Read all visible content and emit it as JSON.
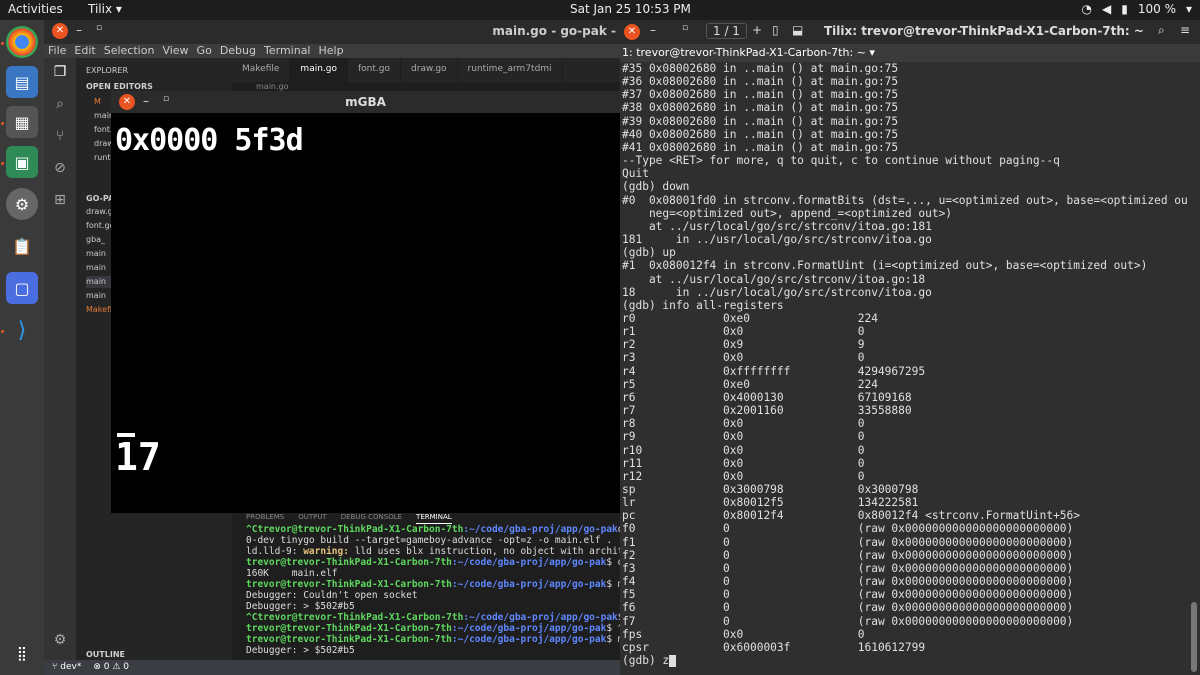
{
  "topbar": {
    "activities": "Activities",
    "app": "Tilix",
    "app_arrow": "▾",
    "clock": "Sat Jan 25  10:53 PM",
    "battery": "100 %"
  },
  "vscode": {
    "title": "main.go - go-pak -",
    "menu": [
      "File",
      "Edit",
      "Selection",
      "View",
      "Go",
      "Debug",
      "Terminal",
      "Help"
    ],
    "explorer": "EXPLORER",
    "open_editors": "OPEN EDITORS",
    "project": "GO-PAK",
    "open_files": [
      "M",
      "main.go",
      "font.go",
      "draw.go",
      "runtime_arm7tdmi"
    ],
    "project_files": [
      "draw.go",
      "font.go",
      "gba_",
      "main",
      "main",
      "main",
      "main",
      "Makefile"
    ],
    "outline": "OUTLINE",
    "tabs": [
      "Makefile",
      "main.go",
      "font.go",
      "draw.go",
      "runtime_arm7tdmi"
    ],
    "breadcrumb": "main.go",
    "terminal_tabs": [
      "PROBLEMS",
      "OUTPUT",
      "DEBUG CONSOLE",
      "TERMINAL"
    ],
    "status": {
      "branch": "dev*",
      "errors": "⊗ 0 ⚠ 0"
    }
  },
  "terminal_lines": [
    {
      "u": "^Ctrevor@trevor-ThinkPad-X1-Carbon-7th",
      "p": ":~/code/gba-proj/app/go-pak",
      "c": "docker run"
    },
    {
      "t": "0-dev tinygo build --target=gameboy-advance -opt=z -o main.elf ."
    },
    {
      "w": "ld.lld-9: ",
      "y": "warning:",
      "t": " lld uses blx instruction, no object with architecture su"
    },
    {
      "u": "trevor@trevor-ThinkPad-X1-Carbon-7th",
      "p": ":~/code/gba-proj/app/go-pak",
      "c": "$ du -sh mai"
    },
    {
      "t": "160K    main.elf"
    },
    {
      "u": "trevor@trevor-ThinkPad-X1-Carbon-7th",
      "p": ":~/code/gba-proj/app/go-pak",
      "c": "$ mgba -4 -g"
    },
    {
      "t": "Debugger: Couldn't open socket"
    },
    {
      "t": "Debugger: > $502#b5"
    },
    {
      "u": "^Ctrevor@trevor-ThinkPad-X1-Carbon-7th",
      "p": ":~/code/gba-proj/app/go-pak",
      "c": "$ ^C"
    },
    {
      "u": "trevor@trevor-ThinkPad-X1-Carbon-7th",
      "p": ":~/code/gba-proj/app/go-pak",
      "c": "$ ^C"
    },
    {
      "u": "trevor@trevor-ThinkPad-X1-Carbon-7th",
      "p": ":~/code/gba-proj/app/go-pak",
      "c": "$ mgba -4 -g"
    },
    {
      "t": "Debugger: > $502#b5"
    }
  ],
  "mgba": {
    "title": "mGBA",
    "hex": "0x0000 5f3d",
    "num": "17"
  },
  "tilix": {
    "title": "Tilix: trevor@trevor-ThinkPad-X1-Carbon-7th: ~",
    "pages": "1 / 1",
    "tab": "1: trevor@trevor-ThinkPad-X1-Carbon-7th: ~"
  },
  "gdb_lines": [
    "#35 0x08002680 in ..main () at main.go:75",
    "#36 0x08002680 in ..main () at main.go:75",
    "#37 0x08002680 in ..main () at main.go:75",
    "#38 0x08002680 in ..main () at main.go:75",
    "#39 0x08002680 in ..main () at main.go:75",
    "#40 0x08002680 in ..main () at main.go:75",
    "#41 0x08002680 in ..main () at main.go:75",
    "--Type <RET> for more, q to quit, c to continue without paging--q",
    "Quit",
    "(gdb) down",
    "#0  0x08001fd0 in strconv.formatBits (dst=..., u=<optimized out>, base=<optimized out>,",
    "    neg=<optimized out>, append_=<optimized out>)",
    "    at ../usr/local/go/src/strconv/itoa.go:181",
    "181     in ../usr/local/go/src/strconv/itoa.go",
    "(gdb) up",
    "#1  0x080012f4 in strconv.FormatUint (i=<optimized out>, base=<optimized out>)",
    "    at ../usr/local/go/src/strconv/itoa.go:18",
    "18      in ../usr/local/go/src/strconv/itoa.go",
    "(gdb) info all-registers",
    "r0             0xe0                224",
    "r1             0x0                 0",
    "r2             0x9                 9",
    "r3             0x0                 0",
    "r4             0xffffffff          4294967295",
    "r5             0xe0                224",
    "r6             0x4000130           67109168",
    "r7             0x2001160           33558880",
    "r8             0x0                 0",
    "r9             0x0                 0",
    "r10            0x0                 0",
    "r11            0x0                 0",
    "r12            0x0                 0",
    "sp             0x3000798           0x3000798",
    "lr             0x80012f5           134222581",
    "pc             0x80012f4           0x80012f4 <strconv.FormatUint+56>",
    "f0             0                   (raw 0x000000000000000000000000)",
    "f1             0                   (raw 0x000000000000000000000000)",
    "f2             0                   (raw 0x000000000000000000000000)",
    "f3             0                   (raw 0x000000000000000000000000)",
    "f4             0                   (raw 0x000000000000000000000000)",
    "f5             0                   (raw 0x000000000000000000000000)",
    "f6             0                   (raw 0x000000000000000000000000)",
    "f7             0                   (raw 0x000000000000000000000000)",
    "fps            0x0                 0",
    "cpsr           0x6000003f          1610612799"
  ],
  "gdb_prompt": "(gdb) z"
}
